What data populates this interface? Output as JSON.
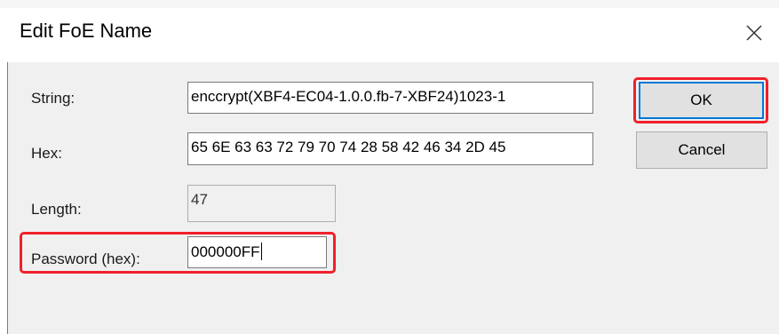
{
  "dialog": {
    "title": "Edit FoE Name"
  },
  "fields": {
    "string": {
      "label": "String:",
      "value": "enccrypt(XBF4-EC04-1.0.0.fb-7-XBF24)1023-1"
    },
    "hex": {
      "label": "Hex:",
      "value": "65 6E 63 63 72 79 70 74 28 58 42 46 34 2D 45"
    },
    "length": {
      "label": "Length:",
      "value": "47"
    },
    "password": {
      "label": "Password (hex):",
      "value": "000000FF"
    }
  },
  "buttons": {
    "ok_label": "OK",
    "cancel_label": "Cancel"
  },
  "icons": {
    "close": "close-icon"
  },
  "colors": {
    "highlight": "#f0202a",
    "default_button_border": "#0078d7",
    "client_background": "#f0f0f0"
  }
}
